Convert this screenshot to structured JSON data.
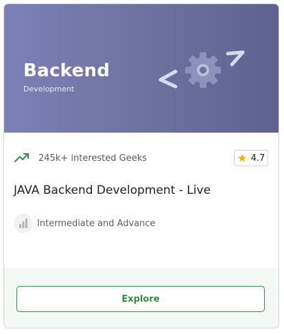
{
  "banner": {
    "title": "Backend",
    "subtitle": "Development",
    "art_icon": "code-gear-icon"
  },
  "meta": {
    "interest_icon": "trending-up-icon",
    "interest_text": "245k+ interested Geeks",
    "rating_icon": "star-icon",
    "rating": "4.7"
  },
  "course": {
    "title": "JAVA Backend Development - Live"
  },
  "level": {
    "icon": "bar-chart-icon",
    "text": "Intermediate and Advance"
  },
  "footer": {
    "button_label": "Explore"
  },
  "colors": {
    "banner_start": "#7b81b6",
    "banner_end": "#5e6291",
    "accent_green": "#2f8d46",
    "star": "#f0b400"
  }
}
